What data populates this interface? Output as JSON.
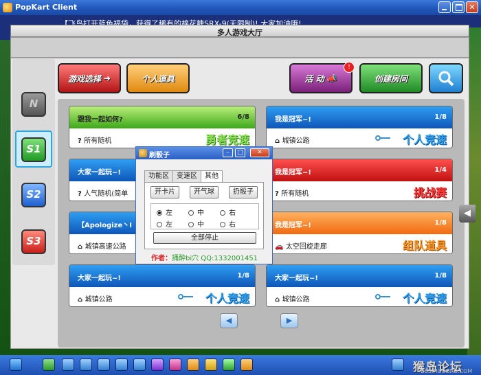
{
  "window": {
    "title": "PopKart Client"
  },
  "marquee": "【飞鸟打开蓝色福袋，获得了稀有的棉花糖SRX-9(无限制)! 大家加油哦!",
  "lobby": {
    "title": "多人游戏大厅"
  },
  "channels": [
    {
      "label": "N",
      "icon": "channel-n-icon"
    },
    {
      "label": "S1",
      "icon": "channel-s1-icon",
      "selected": true
    },
    {
      "label": "S2",
      "icon": "channel-s2-icon"
    },
    {
      "label": "S3",
      "icon": "channel-s3-icon"
    }
  ],
  "actions": {
    "game_select": "游戏选择",
    "my_items": "个人道具",
    "events": "活 动",
    "events_badge": "!",
    "create_room": "创建房间",
    "search_icon": "magnifier-icon"
  },
  "rooms": [
    {
      "title": "跟我一起如何?",
      "count": "6/8",
      "map_marker": "?",
      "map": "所有随机",
      "mode": "勇者竞速",
      "color": "#3da818",
      "locked": false
    },
    {
      "title": "我是冠军~!",
      "count": "1/8",
      "map_marker": "house",
      "map": "城镇公路",
      "mode": "个人竞速",
      "color": "#0e56b8",
      "locked": true
    },
    {
      "title": "大家一起玩~!",
      "count": "",
      "map_marker": "?",
      "map": "人气随机(简单",
      "mode": "",
      "color": "#0e56b8",
      "locked": false
    },
    {
      "title": "我是冠军~!",
      "count": "1/4",
      "map_marker": "?",
      "map": "所有随机",
      "mode": "挑战赛",
      "color": "#c01010",
      "locked": false
    },
    {
      "title": "【Apologize丶I",
      "count": "",
      "map_marker": "house",
      "map": "城镇高速公路",
      "mode": "",
      "color": "#0e56b8",
      "locked": false
    },
    {
      "title": "我是冠军~!",
      "count": "1/8",
      "map_marker": "car",
      "map": "太空回旋走廊",
      "mode": "组队道具",
      "color": "#f06a10",
      "locked": false
    },
    {
      "title": "大家一起玩~!",
      "count": "1/8",
      "map_marker": "house",
      "map": "城镇公路",
      "mode": "个人竞速",
      "color": "#0e56b8",
      "locked": true
    },
    {
      "title": "大家一起玩~!",
      "count": "1/8",
      "map_marker": "house",
      "map": "城镇公路",
      "mode": "个人竞速",
      "color": "#0e56b8",
      "locked": true
    }
  ],
  "pager": {
    "prev": "◀",
    "next": "▶"
  },
  "side_tab": "◀",
  "dialog": {
    "title": "刷骰子",
    "tabs": [
      "功能区",
      "变速区",
      "其他"
    ],
    "active_tab": "其他",
    "buttons": [
      "开卡片",
      "开气球",
      "扔骰子"
    ],
    "radio_rows": [
      [
        {
          "label": "左",
          "checked": true
        },
        {
          "label": "中",
          "checked": false
        },
        {
          "label": "右",
          "checked": false
        }
      ],
      [
        {
          "label": "左",
          "checked": false
        },
        {
          "label": "中",
          "checked": false
        },
        {
          "label": "右",
          "checked": false
        }
      ]
    ],
    "stop_all": "全部停止",
    "author_label": "作者：",
    "author_value": "捅酔bi穴 QQ:1332001451"
  },
  "watermark": {
    "main": "猴岛论坛",
    "sub": "BBS.HOUDAO.COM"
  }
}
